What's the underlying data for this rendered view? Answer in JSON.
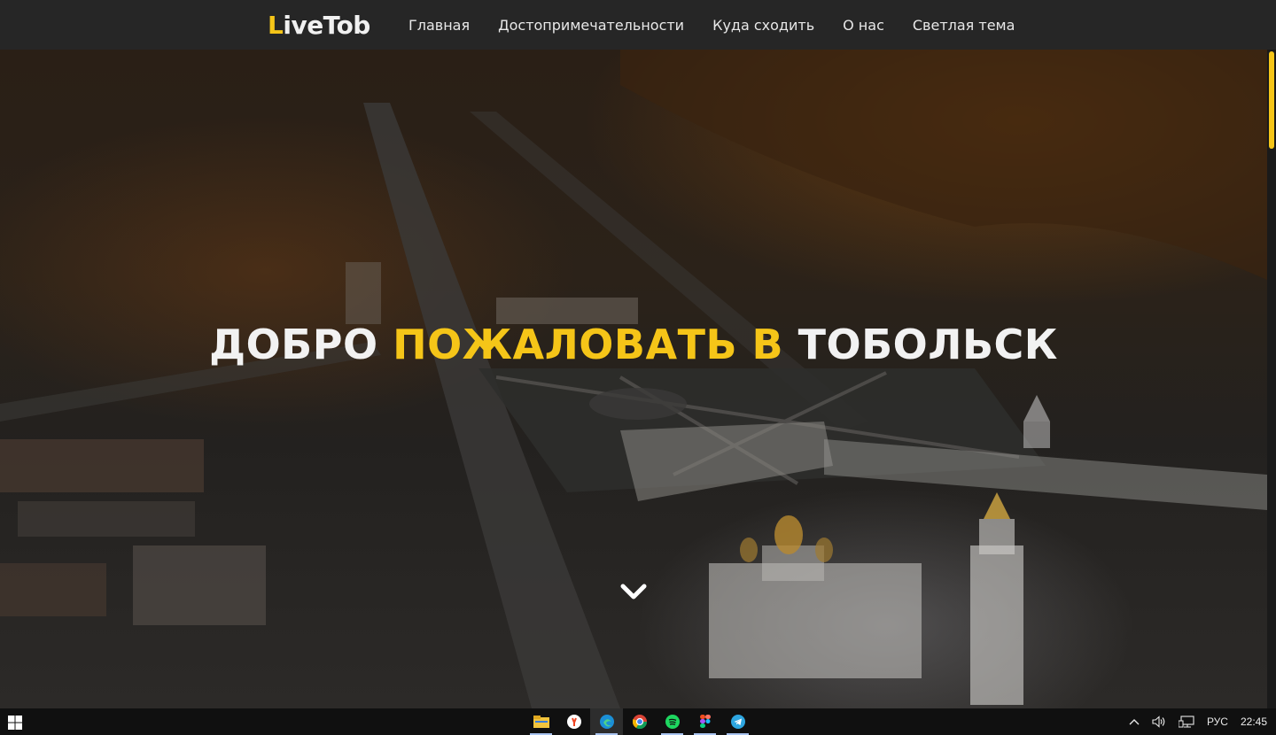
{
  "header": {
    "logo_first": "L",
    "logo_rest": "iveTob",
    "nav": [
      "Главная",
      "Достопримечательности",
      "Куда сходить",
      "О нас",
      "Светлая тема"
    ]
  },
  "hero": {
    "title_part1": "ДОБРО ",
    "title_accent": "ПОЖАЛОВАТЬ В",
    "title_part2": " ТОБОЛЬСК"
  },
  "colors": {
    "accent": "#f5c518",
    "header_bg": "#262626",
    "taskbar_bg": "#101010"
  },
  "taskbar": {
    "apps": [
      "file-explorer-icon",
      "yandex-browser-icon",
      "edge-icon",
      "chrome-icon",
      "spotify-icon",
      "figma-icon",
      "telegram-icon"
    ],
    "language": "РУС",
    "time": "22:45"
  },
  "scroll": {
    "position_fraction": 0.0
  }
}
